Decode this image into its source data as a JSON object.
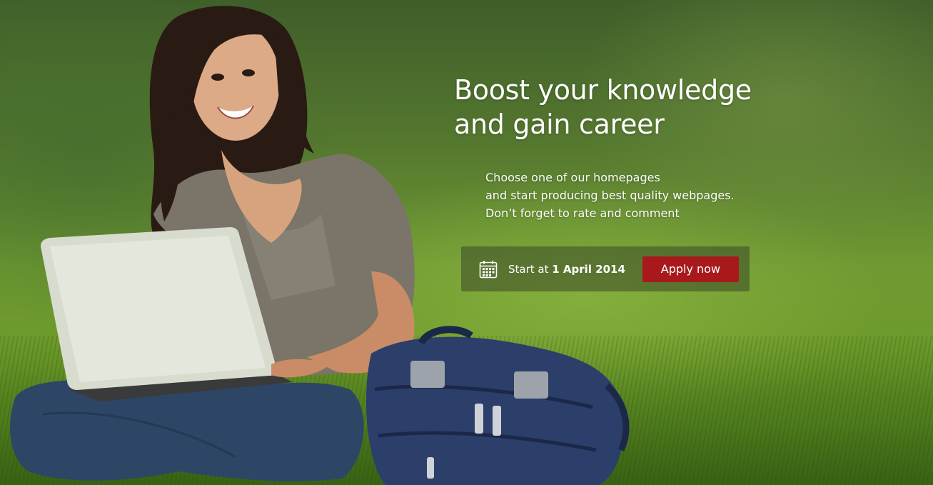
{
  "hero": {
    "headline_line1": "Boost your knowledge",
    "headline_line2": "and gain career",
    "subtext_line1": "Choose one of our homepages",
    "subtext_line2": "and start producing best quality webpages.",
    "subtext_line3": "Don’t forget to rate and comment",
    "start_prefix": "Start at",
    "start_date": "1 April 2014",
    "apply_label": "Apply now",
    "calendar_icon": "calendar-icon",
    "accent_color": "#a8191c"
  }
}
